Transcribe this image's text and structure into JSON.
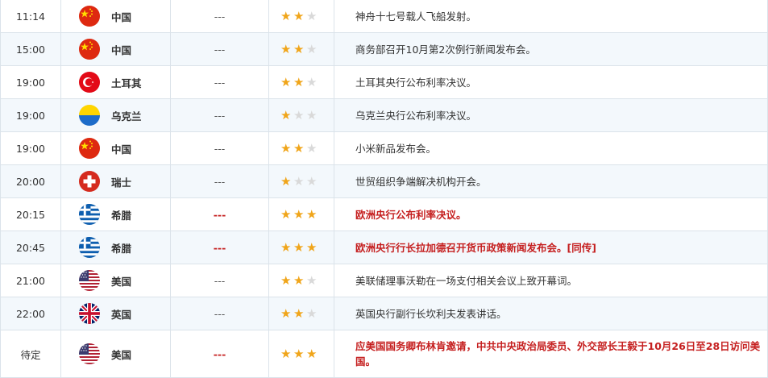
{
  "rows": [
    {
      "time": "11:14",
      "country": "中国",
      "flag": "china-flag",
      "value": "---",
      "stars": 2,
      "event": "神舟十七号载人飞船发射。",
      "high": false
    },
    {
      "time": "15:00",
      "country": "中国",
      "flag": "china-flag",
      "value": "---",
      "stars": 2,
      "event": "商务部召开10月第2次例行新闻发布会。",
      "high": false
    },
    {
      "time": "19:00",
      "country": "土耳其",
      "flag": "turkey-flag",
      "value": "---",
      "stars": 2,
      "event": "土耳其央行公布利率决议。",
      "high": false
    },
    {
      "time": "19:00",
      "country": "乌克兰",
      "flag": "ukraine-flag",
      "value": "---",
      "stars": 1,
      "event": "乌克兰央行公布利率决议。",
      "high": false
    },
    {
      "time": "19:00",
      "country": "中国",
      "flag": "china-flag",
      "value": "---",
      "stars": 2,
      "event": "小米新品发布会。",
      "high": false
    },
    {
      "time": "20:00",
      "country": "瑞士",
      "flag": "switzerland-flag",
      "value": "---",
      "stars": 1,
      "event": "世贸组织争端解决机构开会。",
      "high": false
    },
    {
      "time": "20:15",
      "country": "希腊",
      "flag": "greece-flag",
      "value": "---",
      "stars": 3,
      "event": "欧洲央行公布利率决议。",
      "high": true
    },
    {
      "time": "20:45",
      "country": "希腊",
      "flag": "greece-flag",
      "value": "---",
      "stars": 3,
      "event": "欧洲央行行长拉加德召开货币政策新闻发布会。[同传]",
      "high": true
    },
    {
      "time": "21:00",
      "country": "美国",
      "flag": "usa-flag",
      "value": "---",
      "stars": 2,
      "event": "美联储理事沃勒在一场支付相关会议上致开幕词。",
      "high": false
    },
    {
      "time": "22:00",
      "country": "英国",
      "flag": "uk-flag",
      "value": "---",
      "stars": 2,
      "event": "英国央行副行长坎利夫发表讲话。",
      "high": false
    },
    {
      "time": "待定",
      "country": "美国",
      "flag": "usa-flag",
      "value": "---",
      "stars": 3,
      "event": "应美国国务卿布林肯邀请，中共中央政治局委员、外交部长王毅于10月26日至28日访问美国。",
      "high": true
    }
  ]
}
